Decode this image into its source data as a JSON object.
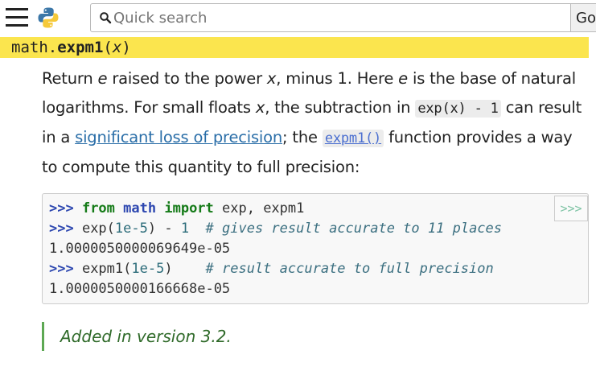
{
  "header": {
    "search_placeholder": "Quick search",
    "go_label": "Go",
    "menu_icon": "hamburger-menu-icon",
    "logo_icon": "python-logo-icon",
    "search_icon": "magnifier-icon"
  },
  "signature": {
    "module": "math.",
    "name": "expm1",
    "open": "(",
    "param": "x",
    "close": ")"
  },
  "description": {
    "t1": "Return ",
    "e1": "e",
    "t2": " raised to the power ",
    "x1": "x",
    "t3": ", minus 1. Here ",
    "e2": "e",
    "t4": " is the base of natural logarithms. For small floats ",
    "x2": "x",
    "t5": ", the subtraction in ",
    "code1": "exp(x) - 1",
    "t6": " can result in a ",
    "link1": "significant loss of precision",
    "t7": "; the ",
    "link2": "expm1()",
    "t8": " function provides a way to compute this quantity to full precision:"
  },
  "code_example": {
    "copy_label": ">>>",
    "line1": {
      "prompt": ">>> ",
      "kw_from": "from",
      "sp1": " ",
      "module": "math",
      "sp2": " ",
      "kw_import": "import",
      "rest": " exp, expm1"
    },
    "line2": {
      "prompt": ">>> ",
      "call": "exp(",
      "num": "1e-5",
      "tail": ") - ",
      "one": "1",
      "gap": "  ",
      "comment": "# gives result accurate to 11 places"
    },
    "line3": "1.0000050000069649e-05",
    "line4": {
      "prompt": ">>> ",
      "call": "expm1(",
      "num": "1e-5",
      "tail": ")",
      "gap": "    ",
      "comment": "# result accurate to full precision"
    },
    "line5": "1.0000050000166668e-05"
  },
  "version_note": "Added in version 3.2.",
  "colors": {
    "signature_bg": "#fbe54e",
    "link": "#2a6ea8",
    "version_border": "#5da853"
  }
}
